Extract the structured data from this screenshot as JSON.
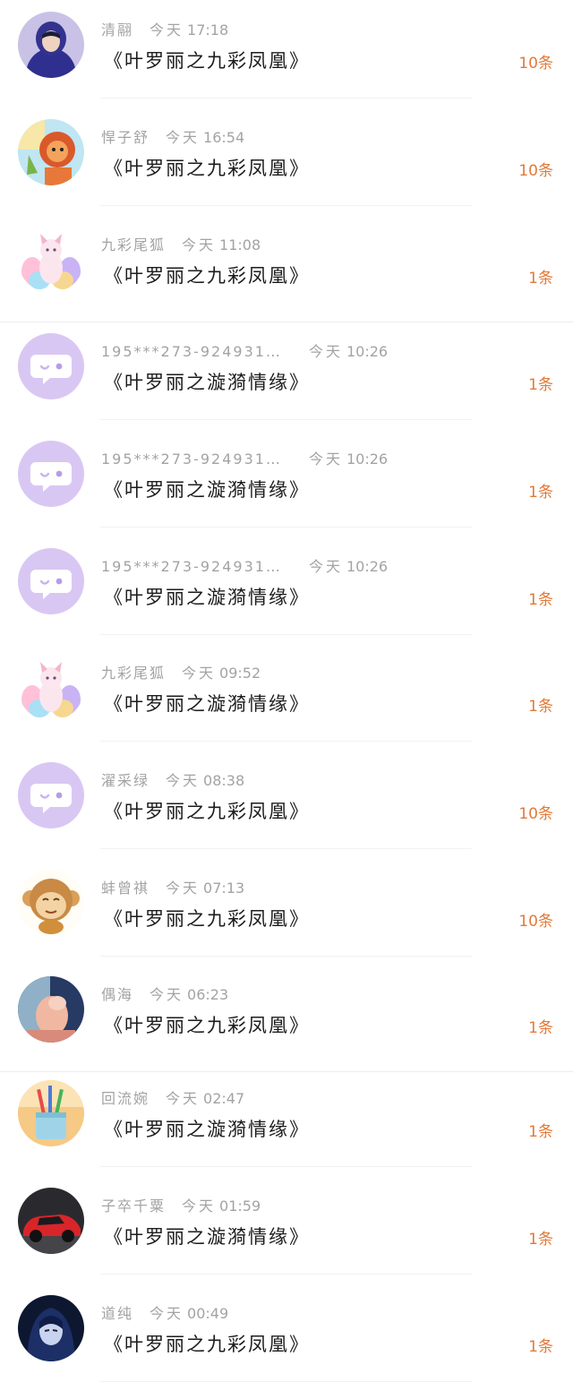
{
  "colors": {
    "accent": "#e07a3a",
    "meta_text": "#a3a3a3",
    "title_text": "#1c1c1c",
    "default_avatar": "#d9c7f3"
  },
  "rows": [
    {
      "name": "清翮",
      "day": "今天",
      "time": "17:18",
      "title": "《叶罗丽之九彩凤凰》",
      "count": "10条",
      "avatar": "hooded-person-avatar"
    },
    {
      "name": "悍子舒",
      "day": "今天",
      "time": "16:54",
      "title": "《叶罗丽之九彩凤凰》",
      "count": "10条",
      "avatar": "cartoon-lion-avatar"
    },
    {
      "name": "九彩尾狐",
      "day": "今天",
      "time": "11:08",
      "title": "《叶罗丽之九彩凤凰》",
      "count": "1条",
      "avatar": "nine-tailed-fox-avatar"
    },
    {
      "name": "195***273-924931…",
      "day": "今天",
      "time": "10:26",
      "title": "《叶罗丽之漩漪情缘》",
      "count": "1条",
      "avatar": "default-chat-bubble-avatar"
    },
    {
      "name": "195***273-924931…",
      "day": "今天",
      "time": "10:26",
      "title": "《叶罗丽之漩漪情缘》",
      "count": "1条",
      "avatar": "default-chat-bubble-avatar"
    },
    {
      "name": "195***273-924931…",
      "day": "今天",
      "time": "10:26",
      "title": "《叶罗丽之漩漪情缘》",
      "count": "1条",
      "avatar": "default-chat-bubble-avatar"
    },
    {
      "name": "九彩尾狐",
      "day": "今天",
      "time": "09:52",
      "title": "《叶罗丽之漩漪情缘》",
      "count": "1条",
      "avatar": "nine-tailed-fox-avatar"
    },
    {
      "name": "濯采绿",
      "day": "今天",
      "time": "08:38",
      "title": "《叶罗丽之九彩凤凰》",
      "count": "10条",
      "avatar": "default-chat-bubble-avatar"
    },
    {
      "name": "蚌曾祺",
      "day": "今天",
      "time": "07:13",
      "title": "《叶罗丽之九彩凤凰》",
      "count": "10条",
      "avatar": "cartoon-monkey-avatar"
    },
    {
      "name": "偶海",
      "day": "今天",
      "time": "06:23",
      "title": "《叶罗丽之九彩凤凰》",
      "count": "1条",
      "avatar": "photo-avatar"
    },
    {
      "name": "回流婉",
      "day": "今天",
      "time": "02:47",
      "title": "《叶罗丽之漩漪情缘》",
      "count": "1条",
      "avatar": "pencil-cup-avatar"
    },
    {
      "name": "子卒千粟",
      "day": "今天",
      "time": "01:59",
      "title": "《叶罗丽之漩漪情缘》",
      "count": "1条",
      "avatar": "red-car-avatar"
    },
    {
      "name": "道纯",
      "day": "今天",
      "time": "00:49",
      "title": "《叶罗丽之九彩凤凰》",
      "count": "1条",
      "avatar": "anime-character-avatar"
    }
  ]
}
